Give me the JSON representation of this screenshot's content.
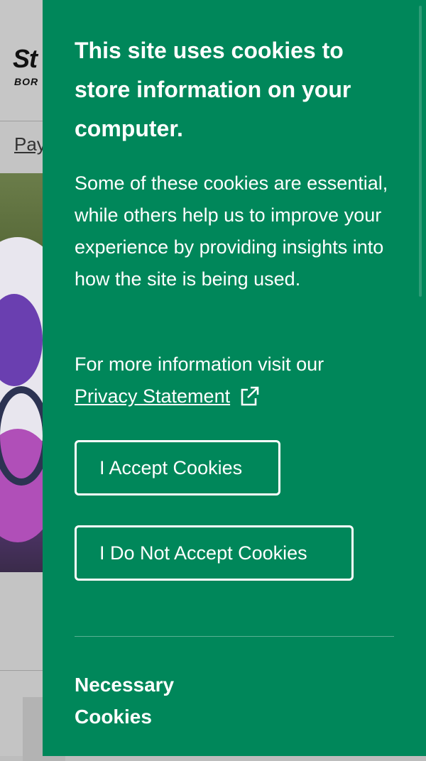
{
  "background": {
    "logo_text": "St",
    "logo_sub": "BOR",
    "nav_link": "Pay"
  },
  "cookie_panel": {
    "title": "This site uses cookies to store information on your computer.",
    "description": "Some of these cookies are essential, while others help us to improve your experience by providing insights into how the site is being used.",
    "more_info_text": "For more information visit our",
    "privacy_link_label": "Privacy Statement",
    "accept_button_label": "I Accept Cookies",
    "reject_button_label": "I Do Not Accept Cookies",
    "section_title": "Necessary Cookies",
    "colors": {
      "panel_bg": "#00875a",
      "text": "#ffffff"
    },
    "icons": {
      "privacy_link": "external-link-icon"
    }
  }
}
